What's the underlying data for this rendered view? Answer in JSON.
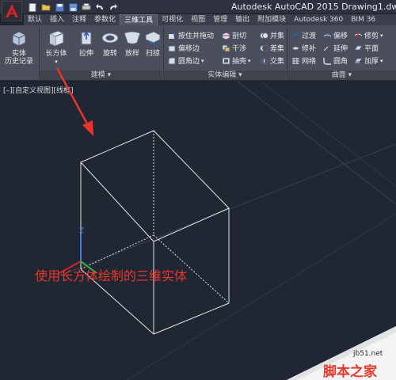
{
  "window": {
    "title": "Autodesk AutoCAD 2015    Drawing1.dw"
  },
  "quick_access": {
    "icons": [
      "new-file-icon",
      "open-icon",
      "save-icon",
      "save-as-icon",
      "print-icon",
      "undo-icon",
      "redo-icon"
    ]
  },
  "tabs": [
    {
      "label": "默认"
    },
    {
      "label": "插入"
    },
    {
      "label": "注释"
    },
    {
      "label": "参数化"
    },
    {
      "label": "三维工具",
      "active": true
    },
    {
      "label": "可视化"
    },
    {
      "label": "视图"
    },
    {
      "label": "管理"
    },
    {
      "label": "输出"
    },
    {
      "label": "附加模块"
    },
    {
      "label": "Autodesk 360"
    },
    {
      "label": "BIM 36"
    }
  ],
  "ribbon": {
    "solid_history": {
      "line1": "实体",
      "line2": "历史记录"
    },
    "modeling": {
      "title": "建模",
      "buttons": [
        {
          "label": "长方体"
        },
        {
          "label": "拉伸"
        },
        {
          "label": "旋转"
        },
        {
          "label": "放样"
        },
        {
          "label": "扫掠"
        }
      ]
    },
    "solid_editing": {
      "title": "实体编辑",
      "items": [
        {
          "label": "按住并拖动"
        },
        {
          "label": "剖切"
        },
        {
          "label": "并集"
        },
        {
          "label": "偏移边"
        },
        {
          "label": "干涉"
        },
        {
          "label": "差集"
        },
        {
          "label": "圆角边"
        },
        {
          "label": "抽壳"
        },
        {
          "label": "交集"
        }
      ]
    },
    "surface": {
      "title": "曲面",
      "items": [
        {
          "label": "过渡"
        },
        {
          "label": "偏移"
        },
        {
          "label": "修剪"
        },
        {
          "label": "修补"
        },
        {
          "label": "延伸"
        },
        {
          "label": "平面"
        },
        {
          "label": "网络"
        },
        {
          "label": "圆角"
        },
        {
          "label": "加厚"
        }
      ]
    }
  },
  "viewport": {
    "label": "[–][自定义视图][线框]"
  },
  "axis": {
    "z_label": "Z"
  },
  "annotation": {
    "text": "使用长方体绘制的三维实体",
    "color": "#e8362c"
  },
  "watermark": {
    "site": "jb51.net",
    "name": "脚本之家"
  },
  "colors": {
    "viewport_bg": "#212633",
    "ribbon_bg": "#4a4f5b",
    "accent_red": "#e8362c",
    "wire": "#e6e6e6"
  }
}
